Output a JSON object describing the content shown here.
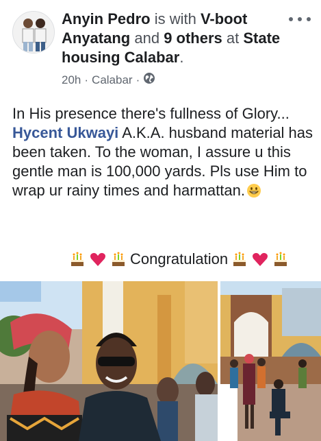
{
  "post": {
    "author": "Anyin Pedro",
    "with_text": " is with ",
    "tagged_person": "V-boot Anyatang",
    "and_text": " and ",
    "others": "9 others",
    "at_text": " at ",
    "location": "State housing Calabar",
    "period": ".",
    "time": "20h",
    "separator1": "·",
    "place": "Calabar",
    "separator2": "·",
    "privacy_icon": "globe-icon",
    "more_icon": "more-dots-icon"
  },
  "body": {
    "line_start": "In His presence there's fullness of Glory... ",
    "mention": "Hycent Ukwayi",
    "line_rest": " A.K.A. husband material has been taken. To the woman, I assure u this gentle man is 100,000 yards. Pls use Him to wrap ur rainy times and harmattan.",
    "emoji": "grinning-face-icon"
  },
  "congrats": {
    "text": "Congratulation",
    "left_icons": [
      "cake-icon",
      "heart-icon",
      "cake-icon"
    ],
    "right_icons": [
      "cake-icon",
      "heart-icon",
      "cake-icon"
    ]
  },
  "colors": {
    "mention_blue": "#385898",
    "meta_gray": "#606770",
    "heart_red": "#e0245e"
  }
}
